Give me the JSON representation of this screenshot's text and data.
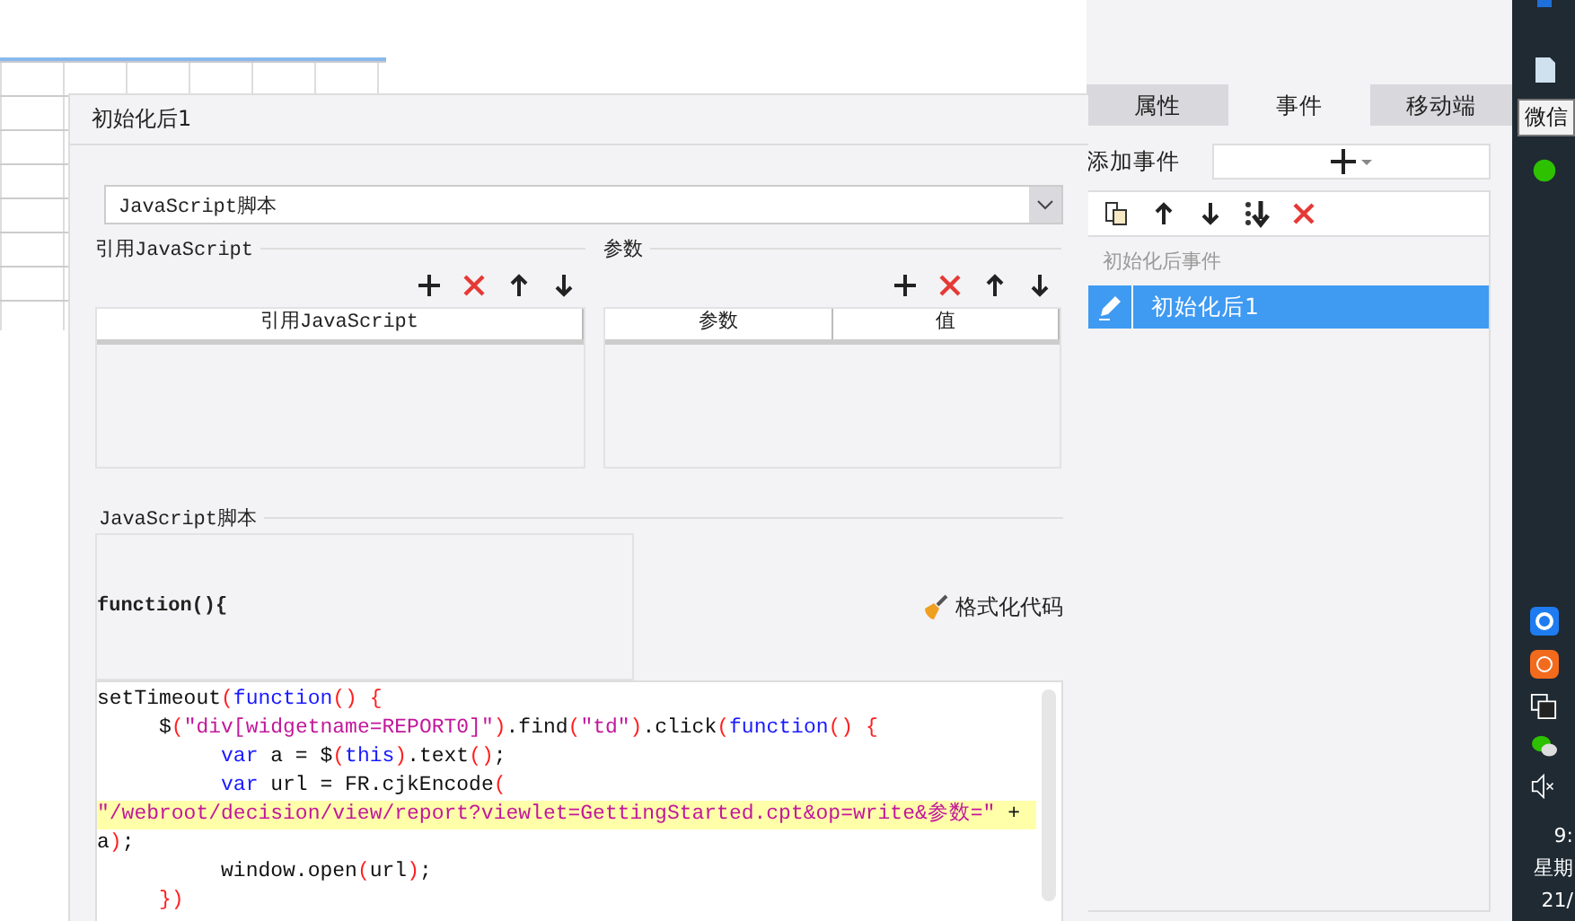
{
  "dialog": {
    "title": "初始化后1",
    "type_select": {
      "value": "JavaScript脚本"
    },
    "imports": {
      "title": "引用JavaScript",
      "tools": [
        {
          "kind": "add"
        },
        {
          "kind": "delete"
        },
        {
          "kind": "up"
        },
        {
          "kind": "down"
        }
      ],
      "columns": [
        "引用JavaScript"
      ]
    },
    "params": {
      "title": "参数",
      "tools": [
        {
          "kind": "add"
        },
        {
          "kind": "delete"
        },
        {
          "kind": "up"
        },
        {
          "kind": "down"
        }
      ],
      "columns": [
        "参数",
        "值"
      ]
    },
    "script": {
      "title": "JavaScript脚本",
      "signature": "function(){",
      "format_button": "格式化代码",
      "lines": [
        {
          "highlighted": false,
          "tokens": [
            {
              "kind": "plain",
              "text": "setTimeout"
            },
            {
              "kind": "bracket",
              "text": "("
            },
            {
              "kind": "keyword",
              "text": "function"
            },
            {
              "kind": "bracket",
              "text": "() {"
            }
          ]
        },
        {
          "highlighted": false,
          "tokens": [
            {
              "kind": "plain",
              "text": "     $"
            },
            {
              "kind": "bracket",
              "text": "("
            },
            {
              "kind": "string",
              "text": "\"div[widgetname=REPORT0]\""
            },
            {
              "kind": "bracket",
              "text": ")"
            },
            {
              "kind": "plain",
              "text": ".find"
            },
            {
              "kind": "bracket",
              "text": "("
            },
            {
              "kind": "string",
              "text": "\"td\""
            },
            {
              "kind": "bracket",
              "text": ")"
            },
            {
              "kind": "plain",
              "text": ".click"
            },
            {
              "kind": "bracket",
              "text": "("
            },
            {
              "kind": "keyword",
              "text": "function"
            },
            {
              "kind": "bracket",
              "text": "() {"
            }
          ]
        },
        {
          "highlighted": false,
          "tokens": [
            {
              "kind": "keyword",
              "text": "          var"
            },
            {
              "kind": "plain",
              "text": " a = $"
            },
            {
              "kind": "bracket",
              "text": "("
            },
            {
              "kind": "keyword",
              "text": "this"
            },
            {
              "kind": "bracket",
              "text": ")"
            },
            {
              "kind": "plain",
              "text": ".text"
            },
            {
              "kind": "bracket",
              "text": "()"
            },
            {
              "kind": "plain",
              "text": ";"
            }
          ]
        },
        {
          "highlighted": false,
          "tokens": [
            {
              "kind": "keyword",
              "text": "          var"
            },
            {
              "kind": "plain",
              "text": " url = FR.cjkEncode"
            },
            {
              "kind": "bracket",
              "text": "("
            }
          ]
        },
        {
          "highlighted": true,
          "tokens": [
            {
              "kind": "string",
              "text": "\"/webroot/decision/view/report?viewlet=GettingStarted.cpt&op=write&参数=\""
            },
            {
              "kind": "plain",
              "text": " +"
            }
          ]
        },
        {
          "highlighted": false,
          "tokens": [
            {
              "kind": "plain",
              "text": "a"
            },
            {
              "kind": "bracket",
              "text": ")"
            },
            {
              "kind": "plain",
              "text": ";"
            }
          ]
        },
        {
          "highlighted": false,
          "tokens": [
            {
              "kind": "plain",
              "text": "          window.open"
            },
            {
              "kind": "bracket",
              "text": "("
            },
            {
              "kind": "plain",
              "text": "url"
            },
            {
              "kind": "bracket",
              "text": ")"
            },
            {
              "kind": "plain",
              "text": ";"
            }
          ]
        },
        {
          "highlighted": false,
          "tokens": [
            {
              "kind": "bracket",
              "text": "     })"
            }
          ]
        }
      ]
    }
  },
  "panel": {
    "tabs": [
      {
        "label": "属性",
        "selected": false
      },
      {
        "label": "事件",
        "selected": true
      },
      {
        "label": "移动端",
        "selected": false
      }
    ],
    "add_event_label": "添加事件",
    "toolbar": [
      {
        "kind": "copy"
      },
      {
        "kind": "up"
      },
      {
        "kind": "down"
      },
      {
        "kind": "bottom"
      },
      {
        "kind": "delete"
      }
    ],
    "group": "初始化后事件",
    "events": [
      {
        "label": "初始化后1",
        "selected": true
      }
    ]
  },
  "taskbar": {
    "tooltip": "微信",
    "clock": [
      "9:",
      "星期",
      "21/"
    ]
  }
}
